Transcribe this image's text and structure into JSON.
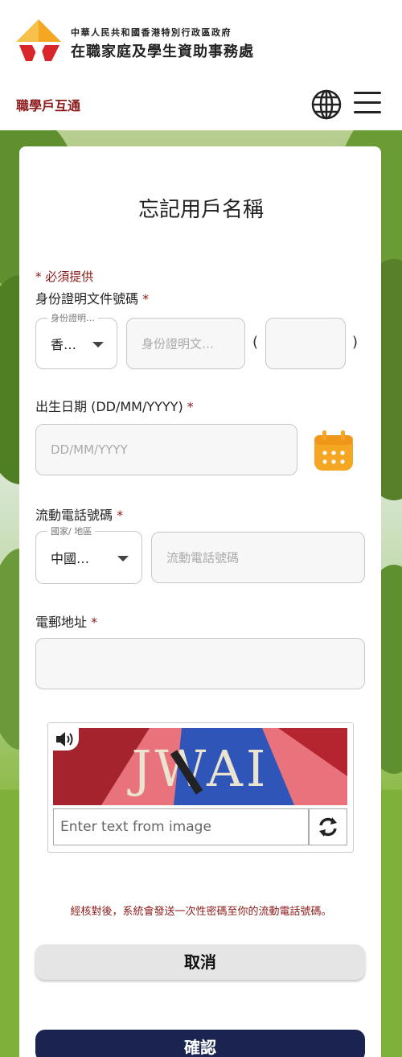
{
  "header": {
    "org_top": "中華人民共和國香港特別行政區政府",
    "org_main": "在職家庭及學生資助事務處",
    "site_name": "職學戶互通"
  },
  "page": {
    "title": "忘記用戶名稱",
    "required_note": "* 必須提供"
  },
  "id_section": {
    "label": "身份證明文件號碼",
    "star": "*",
    "type_legend": "身份證明…",
    "type_value": "香…",
    "number_placeholder": "身份證明文…",
    "paren_open": "(",
    "paren_close": ")"
  },
  "dob": {
    "label": "出生日期 (DD/MM/YYYY)",
    "star": "*",
    "placeholder": "DD/MM/YYYY"
  },
  "mobile": {
    "label": "流動電話號碼",
    "star": "*",
    "region_legend": "國家/ 地區",
    "region_value": "中國…",
    "number_placeholder": "流動電話號碼"
  },
  "email": {
    "label": "電郵地址",
    "star": "*"
  },
  "captcha": {
    "image_text": "JWAI",
    "input_placeholder": "Enter text from image"
  },
  "info_text": "經核對後，系統會發送一次性密碼至你的流動電話號碼。",
  "buttons": {
    "cancel": "取消",
    "confirm": "確認"
  },
  "colors": {
    "brand_red": "#8b1a1a",
    "confirm_bg": "#1b2450",
    "calendar_orange": "#f5a623"
  },
  "icons": [
    "logo-icon",
    "globe-icon",
    "menu-icon",
    "calendar-icon",
    "speaker-icon",
    "refresh-icon",
    "chevron-down-icon"
  ]
}
